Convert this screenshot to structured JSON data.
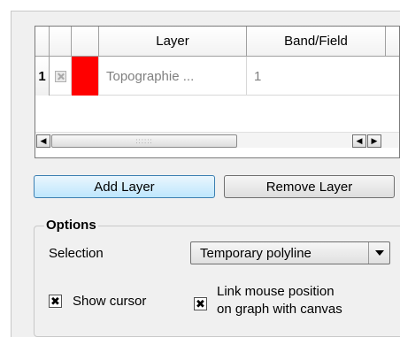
{
  "layer_table": {
    "headers": [
      "",
      "",
      "",
      "Layer",
      "Band/Field"
    ],
    "rows": [
      {
        "index": "1",
        "visible": "disabled",
        "color": "#ff0000",
        "layer": "Topographie ...",
        "band": "1"
      }
    ]
  },
  "scroll": {
    "left_icon": "◀",
    "right_icon": "▶",
    "left2_icon": "◀",
    "thumb_grip": "::::::"
  },
  "buttons": {
    "add_layer": "Add Layer",
    "remove_layer": "Remove Layer"
  },
  "options": {
    "legend": "Options",
    "selection_label": "Selection",
    "selection_value": "Temporary polyline",
    "show_cursor_label": "Show cursor",
    "show_cursor_checked": true,
    "link_mouse_line1": "Link mouse position",
    "link_mouse_line2": "on graph with canvas",
    "link_mouse_checked": true
  },
  "check_mark": "✖"
}
